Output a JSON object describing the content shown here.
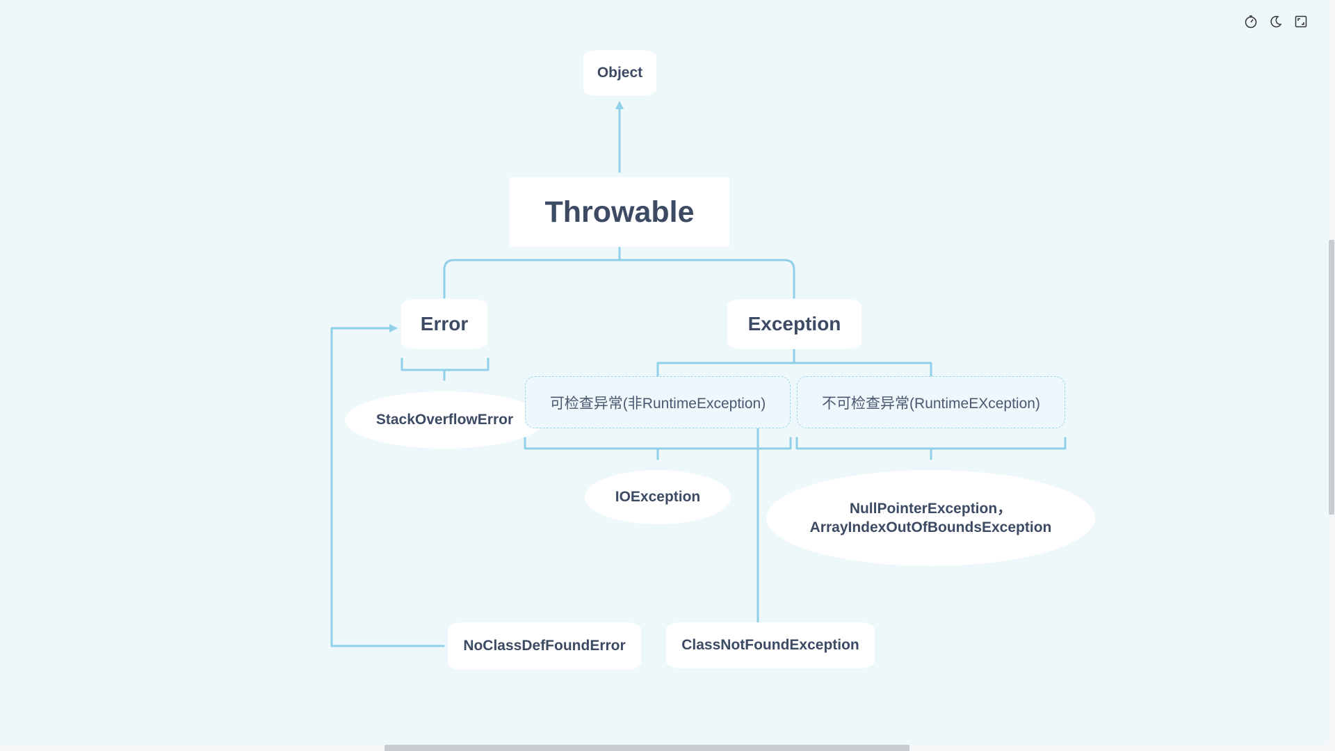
{
  "diagram": {
    "nodes": {
      "object": "Object",
      "throwable": "Throwable",
      "error": "Error",
      "exception": "Exception",
      "stackoverflow": "StackOverflowError",
      "checked": "可检查异常(非RuntimeException)",
      "unchecked": "不可检查异常(RuntimeEXception)",
      "ioexception": "IOException",
      "runtime_examples_line1": "NullPointerException，",
      "runtime_examples_line2": "ArrayIndexOutOfBoundsException",
      "noclassdef": "NoClassDefFoundError",
      "classnotfound": "ClassNotFoundException"
    }
  },
  "toolbar": {
    "icons": [
      "timer-icon",
      "dark-mode-icon",
      "fullscreen-icon"
    ]
  },
  "colors": {
    "background": "#eef7fa",
    "connector": "#8fd0e8",
    "node_fill": "#ffffff",
    "text": "#3c4a63"
  }
}
